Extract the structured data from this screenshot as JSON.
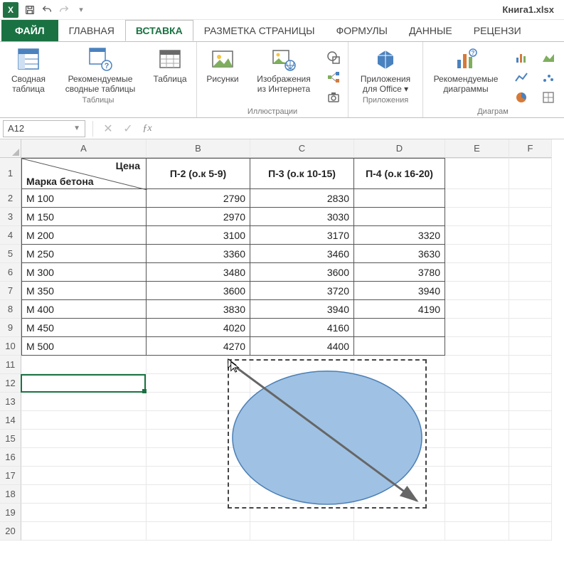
{
  "title": "Книга1.xlsx",
  "tabs": {
    "file": "ФАЙЛ",
    "home": "ГЛАВНАЯ",
    "insert": "ВСТАВКА",
    "layout": "РАЗМЕТКА СТРАНИЦЫ",
    "formulas": "ФОРМУЛЫ",
    "data": "ДАННЫЕ",
    "review": "РЕЦЕНЗИ"
  },
  "ribbon": {
    "tables": {
      "pivot": "Сводная таблица",
      "recommended_pivot": "Рекомендуемые сводные таблицы",
      "table": "Таблица",
      "group": "Таблицы"
    },
    "illustrations": {
      "pictures": "Рисунки",
      "online_pictures_l1": "Изображения",
      "online_pictures_l2": "из Интернета",
      "group": "Иллюстрации"
    },
    "apps": {
      "apps_l1": "Приложения",
      "apps_l2": "для Office ",
      "group": "Приложения"
    },
    "charts": {
      "recommended_l1": "Рекомендуемые",
      "recommended_l2": "диаграммы",
      "group": "Диаграм"
    }
  },
  "namebox": "A12",
  "columns": [
    "A",
    "B",
    "C",
    "D",
    "E",
    "F"
  ],
  "rows": [
    "1",
    "2",
    "3",
    "4",
    "5",
    "6",
    "7",
    "8",
    "9",
    "10",
    "11",
    "12",
    "13",
    "14",
    "15",
    "16",
    "17",
    "18",
    "19",
    "20"
  ],
  "header": {
    "a_top": "Цена",
    "a_bottom": "Марка бетона",
    "b": "П-2 (о.к 5-9)",
    "c": "П-3 (о.к 10-15)",
    "d": "П-4 (о.к 16-20)"
  },
  "data": [
    {
      "a": "М 100",
      "b": "2790",
      "c": "2830",
      "d": ""
    },
    {
      "a": "М 150",
      "b": "2970",
      "c": "3030",
      "d": ""
    },
    {
      "a": "М 200",
      "b": "3100",
      "c": "3170",
      "d": "3320"
    },
    {
      "a": "М 250",
      "b": "3360",
      "c": "3460",
      "d": "3630"
    },
    {
      "a": "М 300",
      "b": "3480",
      "c": "3600",
      "d": "3780"
    },
    {
      "a": "М 350",
      "b": "3600",
      "c": "3720",
      "d": "3940"
    },
    {
      "a": "М 400",
      "b": "3830",
      "c": "3940",
      "d": "4190"
    },
    {
      "a": "М 450",
      "b": "4020",
      "c": "4160",
      "d": ""
    },
    {
      "a": "М 500",
      "b": "4270",
      "c": "4400",
      "d": ""
    }
  ]
}
